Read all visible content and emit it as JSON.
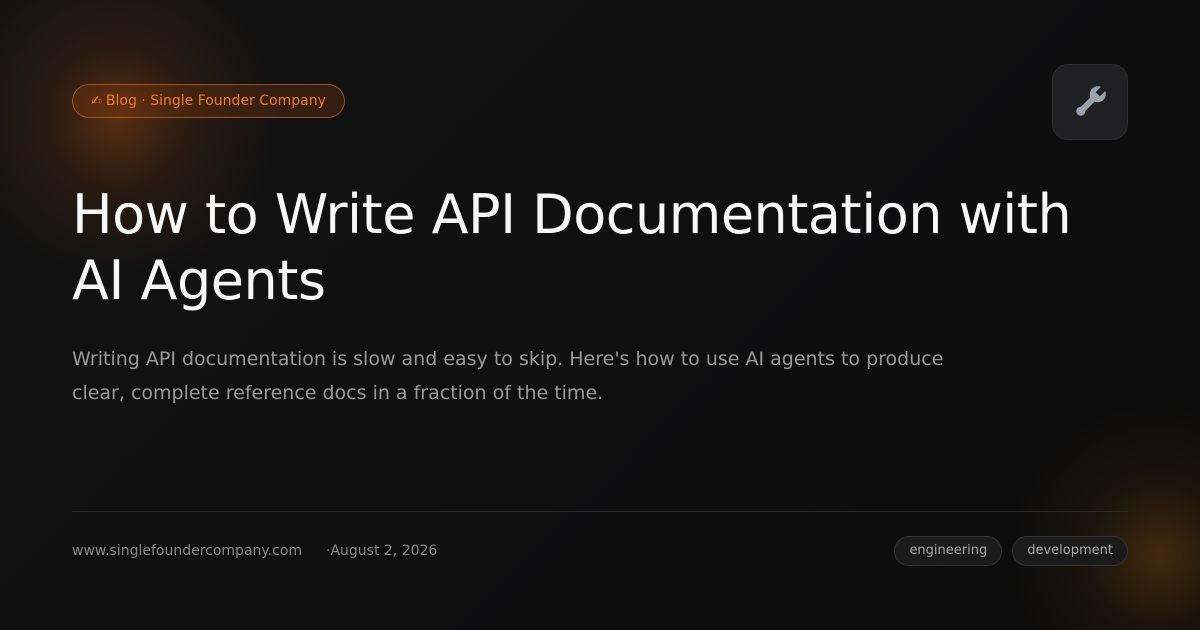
{
  "badge": {
    "emoji": "✍",
    "label": "Blog · Single Founder Company",
    "accent_color": "#f07a2c"
  },
  "icon": {
    "name": "wrench-icon"
  },
  "title": "How to Write API Documentation with AI Agents",
  "subtitle": "Writing API documentation is slow and easy to skip. Here's how to use AI agents to produce clear, complete reference docs in a fraction of the time.",
  "footer": {
    "url": "www.singlefoundercompany.com",
    "date": "·August 2, 2026"
  },
  "tags": [
    "engineering",
    "development"
  ]
}
